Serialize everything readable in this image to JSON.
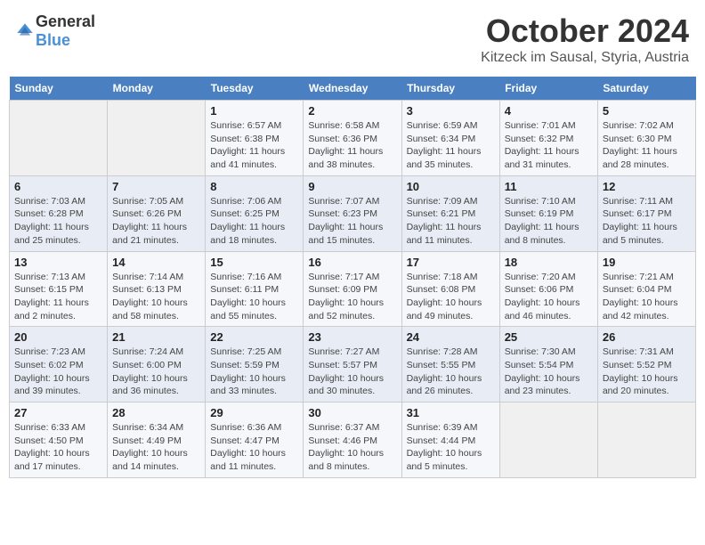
{
  "header": {
    "logo_general": "General",
    "logo_blue": "Blue",
    "month": "October 2024",
    "location": "Kitzeck im Sausal, Styria, Austria"
  },
  "weekdays": [
    "Sunday",
    "Monday",
    "Tuesday",
    "Wednesday",
    "Thursday",
    "Friday",
    "Saturday"
  ],
  "weeks": [
    [
      {
        "day": "",
        "info": ""
      },
      {
        "day": "",
        "info": ""
      },
      {
        "day": "1",
        "info": "Sunrise: 6:57 AM\nSunset: 6:38 PM\nDaylight: 11 hours and 41 minutes."
      },
      {
        "day": "2",
        "info": "Sunrise: 6:58 AM\nSunset: 6:36 PM\nDaylight: 11 hours and 38 minutes."
      },
      {
        "day": "3",
        "info": "Sunrise: 6:59 AM\nSunset: 6:34 PM\nDaylight: 11 hours and 35 minutes."
      },
      {
        "day": "4",
        "info": "Sunrise: 7:01 AM\nSunset: 6:32 PM\nDaylight: 11 hours and 31 minutes."
      },
      {
        "day": "5",
        "info": "Sunrise: 7:02 AM\nSunset: 6:30 PM\nDaylight: 11 hours and 28 minutes."
      }
    ],
    [
      {
        "day": "6",
        "info": "Sunrise: 7:03 AM\nSunset: 6:28 PM\nDaylight: 11 hours and 25 minutes."
      },
      {
        "day": "7",
        "info": "Sunrise: 7:05 AM\nSunset: 6:26 PM\nDaylight: 11 hours and 21 minutes."
      },
      {
        "day": "8",
        "info": "Sunrise: 7:06 AM\nSunset: 6:25 PM\nDaylight: 11 hours and 18 minutes."
      },
      {
        "day": "9",
        "info": "Sunrise: 7:07 AM\nSunset: 6:23 PM\nDaylight: 11 hours and 15 minutes."
      },
      {
        "day": "10",
        "info": "Sunrise: 7:09 AM\nSunset: 6:21 PM\nDaylight: 11 hours and 11 minutes."
      },
      {
        "day": "11",
        "info": "Sunrise: 7:10 AM\nSunset: 6:19 PM\nDaylight: 11 hours and 8 minutes."
      },
      {
        "day": "12",
        "info": "Sunrise: 7:11 AM\nSunset: 6:17 PM\nDaylight: 11 hours and 5 minutes."
      }
    ],
    [
      {
        "day": "13",
        "info": "Sunrise: 7:13 AM\nSunset: 6:15 PM\nDaylight: 11 hours and 2 minutes."
      },
      {
        "day": "14",
        "info": "Sunrise: 7:14 AM\nSunset: 6:13 PM\nDaylight: 10 hours and 58 minutes."
      },
      {
        "day": "15",
        "info": "Sunrise: 7:16 AM\nSunset: 6:11 PM\nDaylight: 10 hours and 55 minutes."
      },
      {
        "day": "16",
        "info": "Sunrise: 7:17 AM\nSunset: 6:09 PM\nDaylight: 10 hours and 52 minutes."
      },
      {
        "day": "17",
        "info": "Sunrise: 7:18 AM\nSunset: 6:08 PM\nDaylight: 10 hours and 49 minutes."
      },
      {
        "day": "18",
        "info": "Sunrise: 7:20 AM\nSunset: 6:06 PM\nDaylight: 10 hours and 46 minutes."
      },
      {
        "day": "19",
        "info": "Sunrise: 7:21 AM\nSunset: 6:04 PM\nDaylight: 10 hours and 42 minutes."
      }
    ],
    [
      {
        "day": "20",
        "info": "Sunrise: 7:23 AM\nSunset: 6:02 PM\nDaylight: 10 hours and 39 minutes."
      },
      {
        "day": "21",
        "info": "Sunrise: 7:24 AM\nSunset: 6:00 PM\nDaylight: 10 hours and 36 minutes."
      },
      {
        "day": "22",
        "info": "Sunrise: 7:25 AM\nSunset: 5:59 PM\nDaylight: 10 hours and 33 minutes."
      },
      {
        "day": "23",
        "info": "Sunrise: 7:27 AM\nSunset: 5:57 PM\nDaylight: 10 hours and 30 minutes."
      },
      {
        "day": "24",
        "info": "Sunrise: 7:28 AM\nSunset: 5:55 PM\nDaylight: 10 hours and 26 minutes."
      },
      {
        "day": "25",
        "info": "Sunrise: 7:30 AM\nSunset: 5:54 PM\nDaylight: 10 hours and 23 minutes."
      },
      {
        "day": "26",
        "info": "Sunrise: 7:31 AM\nSunset: 5:52 PM\nDaylight: 10 hours and 20 minutes."
      }
    ],
    [
      {
        "day": "27",
        "info": "Sunrise: 6:33 AM\nSunset: 4:50 PM\nDaylight: 10 hours and 17 minutes."
      },
      {
        "day": "28",
        "info": "Sunrise: 6:34 AM\nSunset: 4:49 PM\nDaylight: 10 hours and 14 minutes."
      },
      {
        "day": "29",
        "info": "Sunrise: 6:36 AM\nSunset: 4:47 PM\nDaylight: 10 hours and 11 minutes."
      },
      {
        "day": "30",
        "info": "Sunrise: 6:37 AM\nSunset: 4:46 PM\nDaylight: 10 hours and 8 minutes."
      },
      {
        "day": "31",
        "info": "Sunrise: 6:39 AM\nSunset: 4:44 PM\nDaylight: 10 hours and 5 minutes."
      },
      {
        "day": "",
        "info": ""
      },
      {
        "day": "",
        "info": ""
      }
    ]
  ]
}
